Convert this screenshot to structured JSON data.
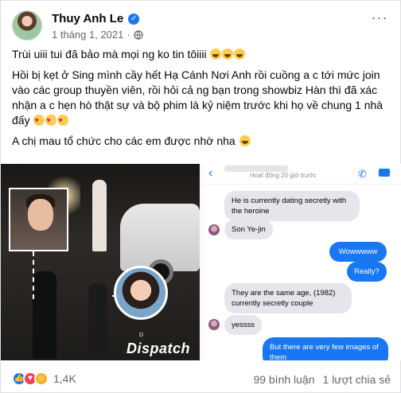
{
  "post": {
    "author": "Thuy Anh Le",
    "date": "1 tháng 1, 2021",
    "separator": "·",
    "more_icon": "more-horizontal-icon"
  },
  "content": {
    "para1": "Trùi uiii tui đã bảo mà mọi ng ko tin tôiiii",
    "para2": "Hồi bị kẹt ở Sing mình cầy hết Hạ Cánh Nơi Anh rồi cuồng a c tới mức join vào các group thuyền viên, rồi hỏi cả ng bạn trong showbiz Hàn thì đã xác nhận a c hẹn hò thật sự và bộ phim là kỷ niệm trước khi họ về chung 1 nhà đấy",
    "para3": "A chị mau tổ chức cho các em được nhờ nha"
  },
  "photo": {
    "watermark": "Dispatch",
    "watermark_sub": "D"
  },
  "chat": {
    "status": "Hoạt động 20 giờ trước",
    "messages": [
      {
        "dir": "in",
        "text": "He is currently dating secretly with the heroine"
      },
      {
        "dir": "in",
        "text": "Son Ye-jin"
      },
      {
        "dir": "out",
        "text": "Wowwwww"
      },
      {
        "dir": "out",
        "text": "Really?"
      },
      {
        "dir": "in",
        "text": "They are the same age, (1982) currently secretly couple"
      },
      {
        "dir": "in",
        "text": "yessss"
      },
      {
        "dir": "out",
        "text": "But there are very few images of them"
      }
    ]
  },
  "footer": {
    "reaction_count": "1,4K",
    "comments": "99 bình luận",
    "shares": "1 lượt chia sẻ"
  },
  "colors": {
    "accent": "#1877f2",
    "secondary_text": "#65676b",
    "bubble_in": "#e4e6eb"
  }
}
